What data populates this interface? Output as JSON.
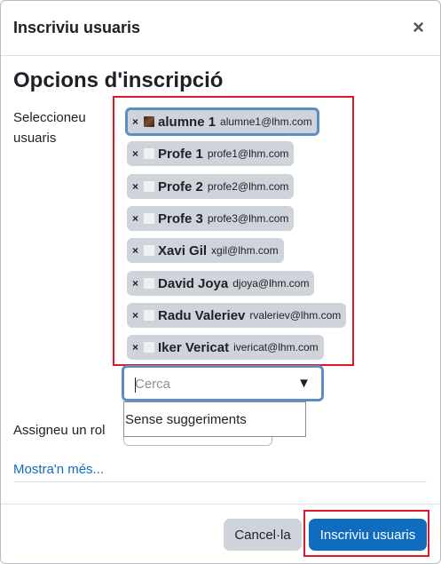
{
  "dialog": {
    "title": "Inscriviu usuaris",
    "close_icon": "close-icon",
    "section_heading": "Opcions d'inscripció"
  },
  "form": {
    "select_users_label": "Seleccioneu usuaris",
    "assign_role_label": "Assigneu un rol",
    "more_link": "Mostra'n més...",
    "search": {
      "placeholder": "Cerca",
      "value": "",
      "dropdown_icon": "triangle-down-icon"
    },
    "suggestions_text": "Sense suggeriments"
  },
  "selected_users": [
    {
      "name": "alumne 1",
      "email": "alumne1@lhm.com",
      "avatar": "photo-avatar",
      "focused": true
    },
    {
      "name": "Profe 1",
      "email": "profe1@lhm.com",
      "avatar": "default-avatar"
    },
    {
      "name": "Profe 2",
      "email": "profe2@lhm.com",
      "avatar": "default-avatar"
    },
    {
      "name": "Profe 3",
      "email": "profe3@lhm.com",
      "avatar": "default-avatar"
    },
    {
      "name": "Xavi Gil",
      "email": "xgil@lhm.com",
      "avatar": "default-avatar"
    },
    {
      "name": "David Joya",
      "email": "djoya@lhm.com",
      "avatar": "default-avatar"
    },
    {
      "name": "Radu Valeriev",
      "email": "rvaleriev@lhm.com",
      "avatar": "default-avatar"
    },
    {
      "name": "Iker Vericat",
      "email": "ivericat@lhm.com",
      "avatar": "default-avatar"
    }
  ],
  "chip_remove_glyph": "×",
  "footer": {
    "cancel_label": "Cancel·la",
    "submit_label": "Inscriviu usuaris"
  },
  "colors": {
    "primary": "#0f6cbf",
    "chip_bg": "#ced4da",
    "focus_ring": "#5b8ec7",
    "highlight_outline": "#e0162b"
  }
}
